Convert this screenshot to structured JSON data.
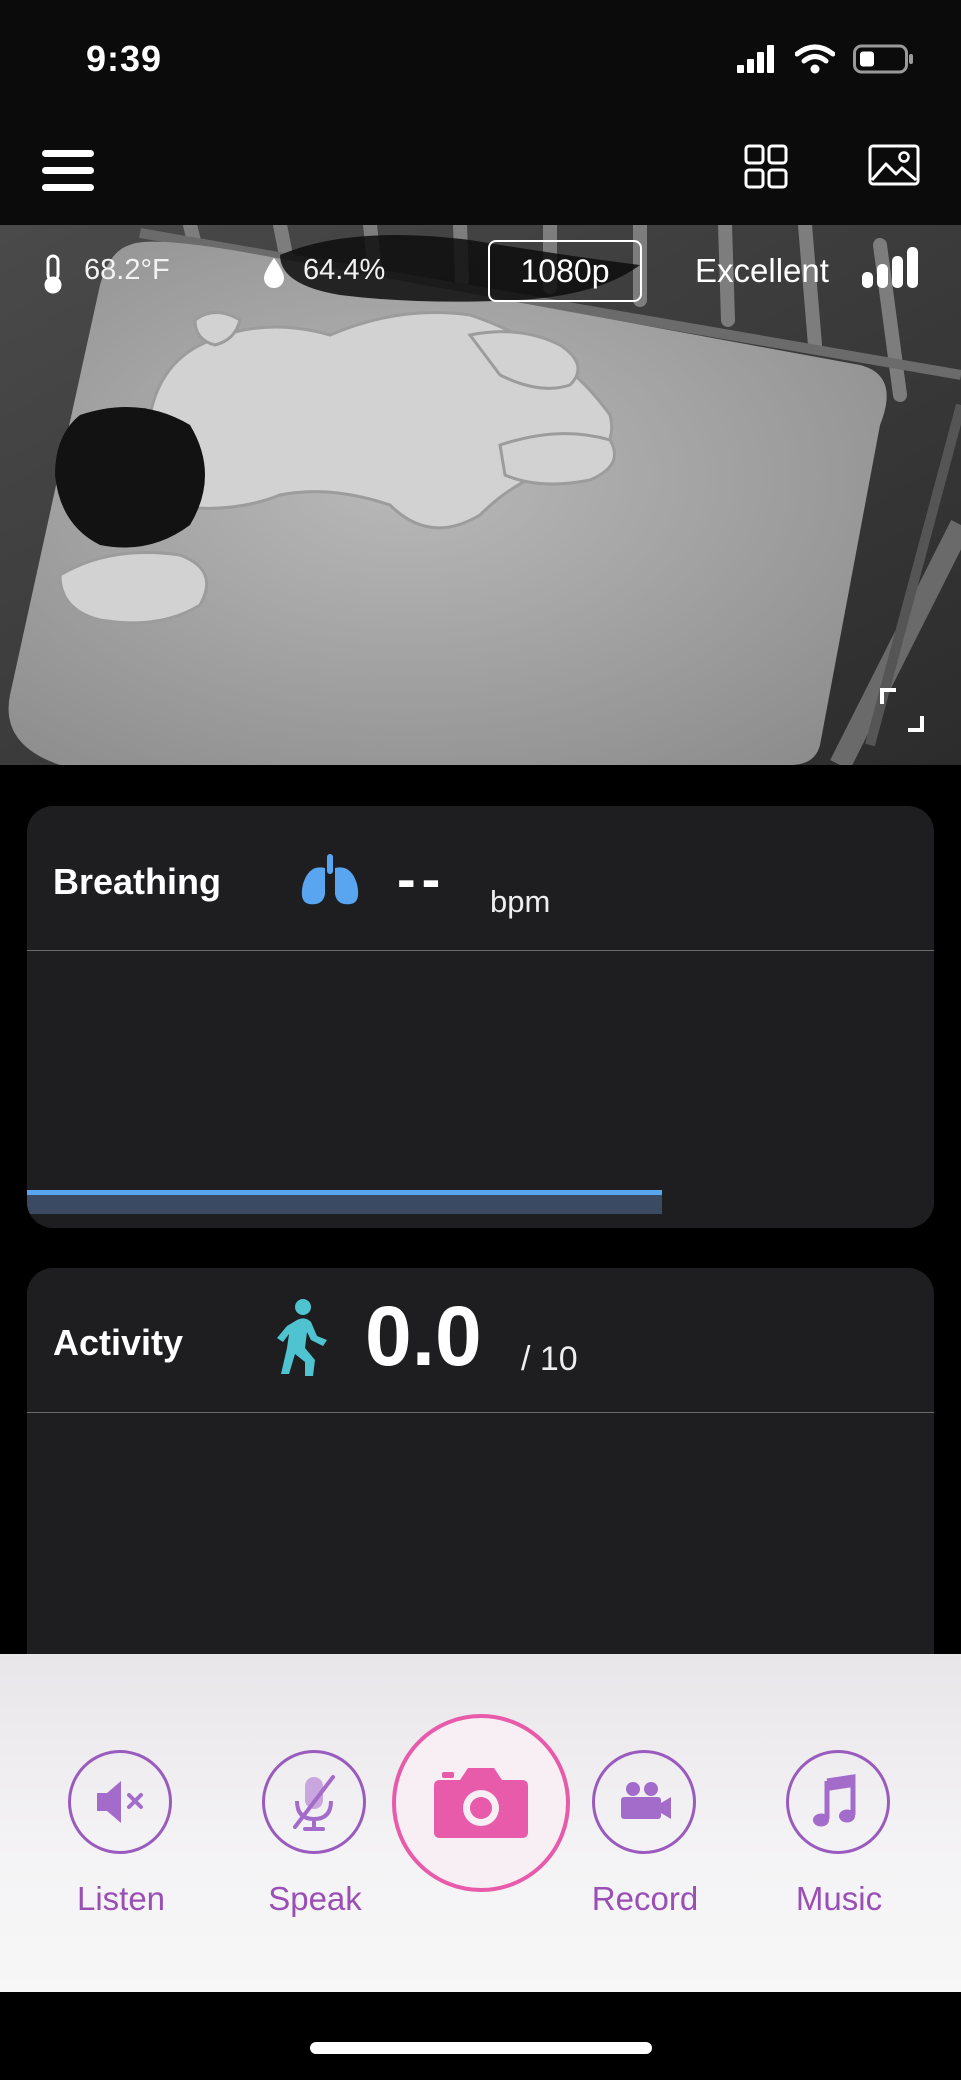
{
  "status": {
    "time": "9:39"
  },
  "video": {
    "temperature": "68.2°F",
    "humidity": "64.4%",
    "resolution": "1080p",
    "connection": "Excellent"
  },
  "breathing": {
    "title": "Breathing",
    "value": "--",
    "unit": "bpm",
    "progress": 0.7
  },
  "activity": {
    "title": "Activity",
    "value": "0.0",
    "scale": "/ 10"
  },
  "controls": {
    "listen": "Listen",
    "speak": "Speak",
    "record": "Record",
    "music": "Music"
  },
  "colors": {
    "accent_purple": "#9a5bbf",
    "accent_pink": "#e85aaa",
    "breathing_blue": "#5aa5f0",
    "activity_teal": "#4fc3d0"
  }
}
